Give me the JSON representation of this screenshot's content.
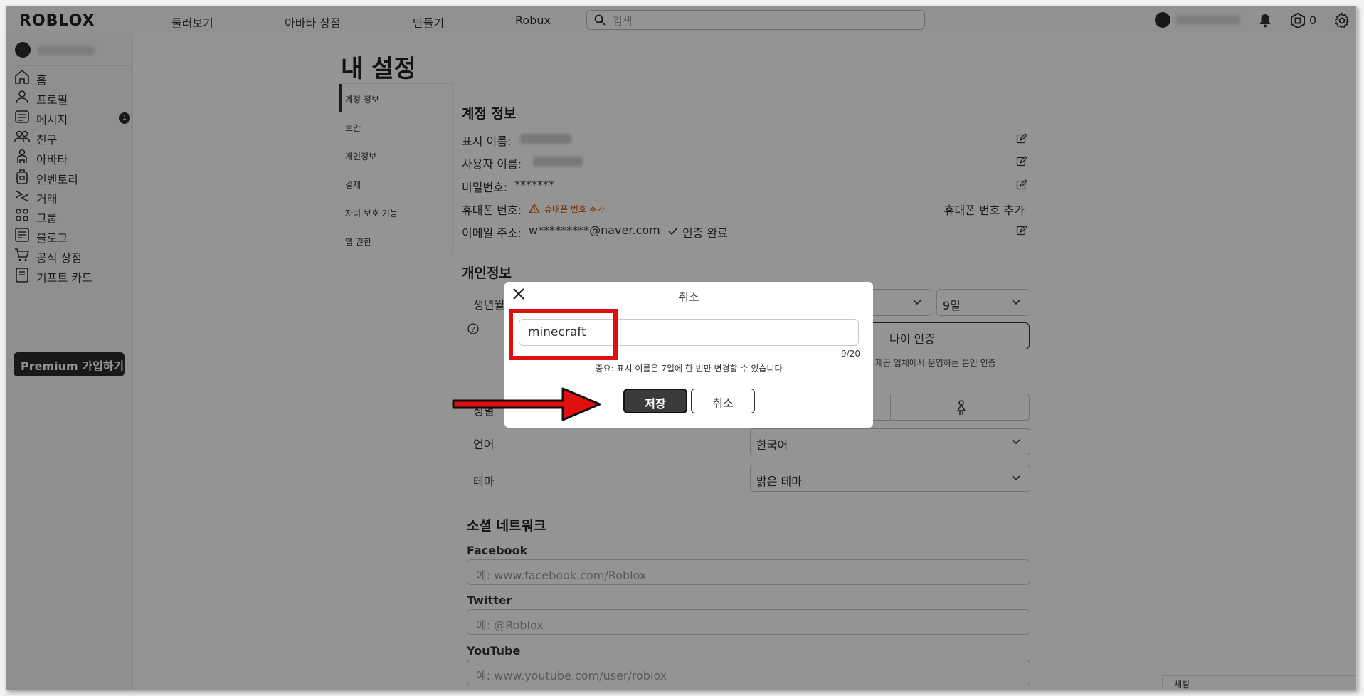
{
  "topbar": {
    "logo": "ROBLOX",
    "nav": [
      "둘러보기",
      "아바타 상점",
      "만들기",
      "Robux"
    ],
    "search_placeholder": "검색",
    "robux_count": "0"
  },
  "sidebar": {
    "items": [
      {
        "label": "홈",
        "icon": "home-icon"
      },
      {
        "label": "프로필",
        "icon": "profile-icon"
      },
      {
        "label": "메시지",
        "icon": "messages-icon",
        "badge": "1"
      },
      {
        "label": "친구",
        "icon": "friends-icon"
      },
      {
        "label": "아바타",
        "icon": "avatar-icon"
      },
      {
        "label": "인벤토리",
        "icon": "inventory-icon"
      },
      {
        "label": "거래",
        "icon": "trade-icon"
      },
      {
        "label": "그룹",
        "icon": "groups-icon"
      },
      {
        "label": "블로그",
        "icon": "blog-icon"
      },
      {
        "label": "공식 상점",
        "icon": "shop-icon"
      },
      {
        "label": "기프트 카드",
        "icon": "gift-card-icon"
      }
    ],
    "premium_label": "Premium 가입하기"
  },
  "page": {
    "title": "내 설정",
    "settings_nav": [
      "계정 정보",
      "보안",
      "개인정보",
      "결제",
      "자녀 보호 기능",
      "앱 권한"
    ],
    "account": {
      "section_title": "계정 정보",
      "display_name_label": "표시 이름:",
      "username_label": "사용자 이름:",
      "password_label": "비밀번호:",
      "password_value": "*******",
      "phone_label": "휴대폰 번호:",
      "phone_warning": "휴대폰 번호 추가",
      "phone_add": "휴대폰 번호 추가",
      "email_label": "이메일 주소:",
      "email_value": "w*********@naver.com",
      "email_verified": "인증 완료"
    },
    "personal": {
      "section_title": "개인정보",
      "birthday_label": "생년월일",
      "day_value": "9일",
      "verify_label": "나이 인증",
      "verify_note": "비스 제공 업체에서 운영하는 본인 인증",
      "gender_label": "성별",
      "language_label": "언어",
      "language_value": "한국어",
      "theme_label": "테마",
      "theme_value": "밝은 테마"
    },
    "social": {
      "section_title": "소셜 네트워크",
      "facebook_label": "Facebook",
      "facebook_placeholder": "예: www.facebook.com/Roblox",
      "twitter_label": "Twitter",
      "twitter_placeholder": "예: @Roblox",
      "youtube_label": "YouTube",
      "youtube_placeholder": "예: www.youtube.com/user/roblox"
    },
    "chat_label": "채팅"
  },
  "modal": {
    "title": "취소",
    "input_value": "minecraft",
    "counter": "9/20",
    "note": "중요: 표시 이름은 7일에 한 번만 변경할 수 있습니다",
    "save_label": "저장",
    "cancel_label": "취소"
  },
  "colors": {
    "highlight": "#e01010",
    "save_button": "#393b3d",
    "warning": "#d14a00"
  }
}
